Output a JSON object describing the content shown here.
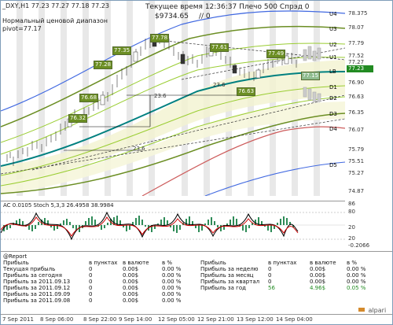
{
  "header": {
    "symbol_line": "_DXY,H1  77.23 77.27 77.18 77.23",
    "range_label": "Нормальный ценовой диапазон",
    "pivot_label": "pivot=77.17",
    "time_label": "Текущее время 12:36:37 Плечо 500 Спрэд 0",
    "balance": "$9734.65",
    "balance_suffix": "// 0"
  },
  "levels": [
    "U4",
    "U3",
    "U2",
    "U1",
    "LB",
    "D1",
    "D2",
    "D3",
    "D4",
    "D5"
  ],
  "price_axis": [
    "78.375",
    "78.07",
    "77.79",
    "77.52",
    "77.27",
    "77.23",
    "76.90",
    "76.63",
    "76.35",
    "76.07",
    "75.79",
    "75.51",
    "75.27",
    "74.87"
  ],
  "current_price": "77.23",
  "bubbles": [
    "77.78",
    "77.35",
    "77.28",
    "77.61",
    "77.49",
    "77.15",
    "76.68",
    "76.32",
    "76.63",
    "23.6",
    "23.6",
    "23.6",
    "76.6"
  ],
  "indicator": {
    "label": "AC 0.0105  Stoch 5,3,3  26.4958  38.9984",
    "axis": [
      "86",
      "80",
      "20",
      "20",
      "-0.2066"
    ]
  },
  "report": {
    "title": "@Report",
    "col_headers_left": [
      "Прибыль",
      "в пунктах",
      "в валюте",
      "в %"
    ],
    "rows_left": [
      [
        "Текущая прибыль",
        "0",
        "0.00$",
        "0.00 %"
      ],
      [
        "Прибыль за сегодня",
        "0",
        "0.00$",
        "0.00 %"
      ],
      [
        "Прибыль за 2011.09.13",
        "0",
        "0.00$",
        "0.00 %"
      ],
      [
        "Прибыль за 2011.09.12",
        "0",
        "0.00$",
        "0.00 %"
      ],
      [
        "Прибыль за 2011.09.09",
        "0",
        "0.00$",
        "0.00 %"
      ],
      [
        "Прибыль за 2011.09.08",
        "0",
        "0.00$",
        "0.00 %"
      ]
    ],
    "col_headers_right": [
      "Прибыль",
      "в пунктах",
      "в валюте",
      "в %"
    ],
    "rows_right": [
      [
        "Прибыль за неделю",
        "0",
        "0.00$",
        "0.00 %"
      ],
      [
        "Прибыль за месяц",
        "0",
        "0.00$",
        "0.00 %"
      ],
      [
        "Прибыль за квартал",
        "0",
        "0.00$",
        "0.00 %"
      ],
      [
        "Прибыль за год",
        "56",
        "4.96$",
        "0.05 %"
      ]
    ],
    "logo": "alpari"
  },
  "time_axis": [
    "7 Sep 2011",
    "8 Sep 06:00",
    "8 Sep 22:00",
    "9 Sep 14:00",
    "12 Sep 05:00",
    "12 Sep 21:00",
    "13 Sep 12:00",
    "14 Sep 04:00"
  ],
  "colors": {
    "accent": "#228b22",
    "band": "#9acd32",
    "mid": "#008080",
    "blue": "#4169e1",
    "red": "#cd5c5c"
  }
}
